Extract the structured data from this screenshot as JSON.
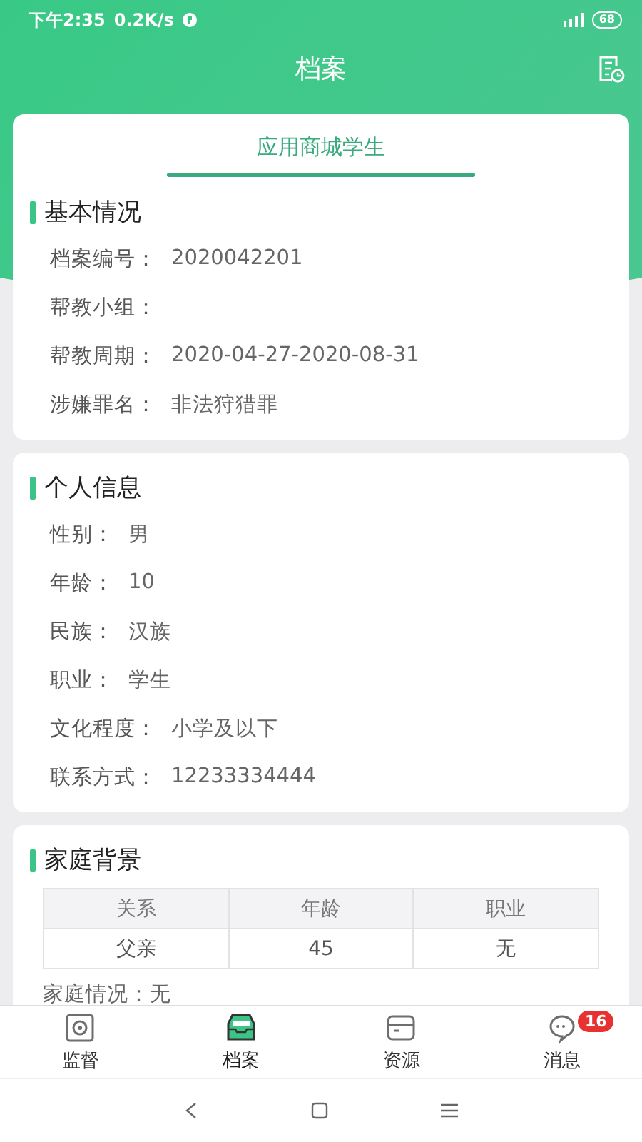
{
  "status_bar": {
    "time": "下午2:35",
    "speed": "0.2K/s",
    "battery": "68"
  },
  "header": {
    "title": "档案"
  },
  "profile": {
    "name": "应用商城学生"
  },
  "sections": [
    {
      "kind": "fields",
      "title": "基本情况",
      "fields": [
        {
          "label": "档案编号：",
          "value": "2020042201"
        },
        {
          "label": "帮教小组："
        },
        {
          "label": "帮教周期：",
          "value": "2020-04-27-2020-08-31"
        },
        {
          "label": "涉嫌罪名：",
          "value": "非法狩猎罪"
        }
      ]
    },
    {
      "kind": "fields",
      "title": "个人信息",
      "fields": [
        {
          "label": "性别：",
          "value": "男"
        },
        {
          "label": "年龄：",
          "value": "10"
        },
        {
          "label": "民族：",
          "value": "汉族"
        },
        {
          "label": "职业：",
          "value": "学生"
        },
        {
          "label": "文化程度：",
          "value": "小学及以下"
        },
        {
          "label": "联系方式：",
          "value": "12233334444"
        }
      ]
    },
    {
      "kind": "table",
      "title": "家庭背景",
      "columns": [
        "关系",
        "年龄",
        "职业"
      ],
      "rows": [
        [
          "父亲",
          "45",
          "无"
        ]
      ],
      "note": "家庭情况：无"
    }
  ],
  "tabs": [
    {
      "label": "监督",
      "selected": false
    },
    {
      "label": "档案",
      "selected": true
    },
    {
      "label": "资源",
      "selected": false
    },
    {
      "label": "消息",
      "selected": false,
      "badge": "16"
    }
  ]
}
